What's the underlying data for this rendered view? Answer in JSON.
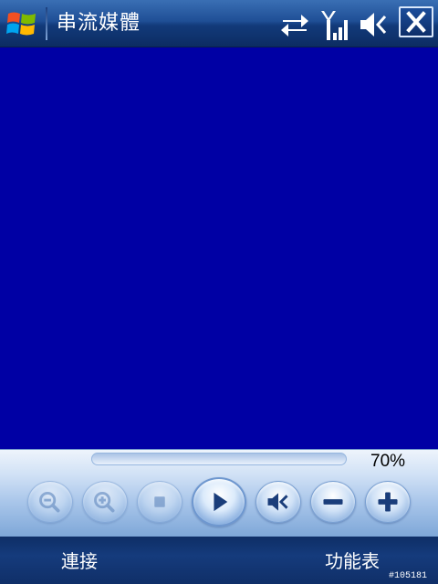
{
  "title_bar": {
    "app_title": "串流媒體",
    "start_icon": "windows-flag-icon",
    "status_icons": [
      "connectivity-icon",
      "signal-icon",
      "speaker-mute-icon"
    ],
    "close_icon": "close-icon"
  },
  "video": {
    "background_color": "#0000a4"
  },
  "controls": {
    "progress": 0,
    "volume_readout": "70%",
    "buttons": [
      {
        "name": "zoom-out-button",
        "icon": "zoom-out-icon",
        "enabled": false
      },
      {
        "name": "zoom-in-button",
        "icon": "zoom-in-icon",
        "enabled": false
      },
      {
        "name": "stop-button",
        "icon": "stop-icon",
        "enabled": false
      },
      {
        "name": "play-button",
        "icon": "play-icon",
        "enabled": true
      },
      {
        "name": "mute-button",
        "icon": "speaker-mute-icon",
        "enabled": true
      },
      {
        "name": "volume-down-button",
        "icon": "minus-icon",
        "enabled": true
      },
      {
        "name": "volume-up-button",
        "icon": "plus-icon",
        "enabled": true
      }
    ]
  },
  "softkeys": {
    "left": "連接",
    "right": "功能表"
  },
  "watermark": "#105181",
  "colors": {
    "accent": "#1f4f96",
    "video_bg": "#0000a4"
  }
}
